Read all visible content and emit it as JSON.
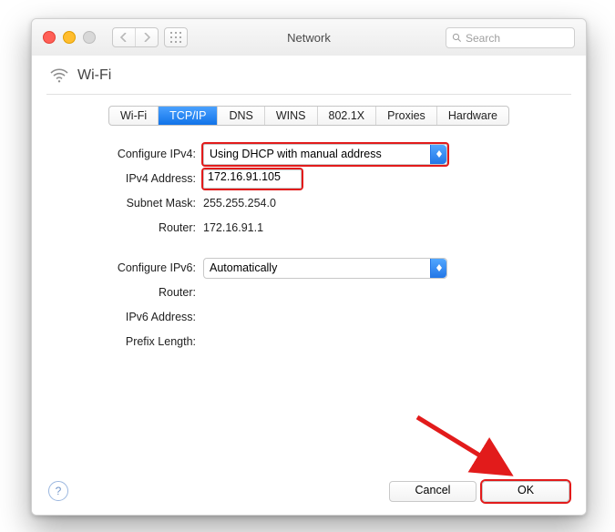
{
  "window": {
    "title": "Network",
    "search_placeholder": "Search"
  },
  "pane": {
    "title": "Wi-Fi"
  },
  "tabs": [
    "Wi-Fi",
    "TCP/IP",
    "DNS",
    "WINS",
    "802.1X",
    "Proxies",
    "Hardware"
  ],
  "activeTab": 1,
  "fields": {
    "configure_ipv4_label": "Configure IPv4:",
    "configure_ipv4_value": "Using DHCP with manual address",
    "ipv4_address_label": "IPv4 Address:",
    "ipv4_address_value": "172.16.91.105",
    "subnet_mask_label": "Subnet Mask:",
    "subnet_mask_value": "255.255.254.0",
    "router_label": "Router:",
    "router_value": "172.16.91.1",
    "configure_ipv6_label": "Configure IPv6:",
    "configure_ipv6_value": "Automatically",
    "router6_label": "Router:",
    "router6_value": "",
    "ipv6_address_label": "IPv6 Address:",
    "ipv6_address_value": "",
    "prefix_length_label": "Prefix Length:",
    "prefix_length_value": ""
  },
  "buttons": {
    "cancel": "Cancel",
    "ok": "OK",
    "help": "?"
  },
  "highlights": {
    "configure_ipv4": true,
    "ipv4_address": true,
    "ok": true
  },
  "annotation": {
    "arrow_color": "#e21b1b"
  }
}
